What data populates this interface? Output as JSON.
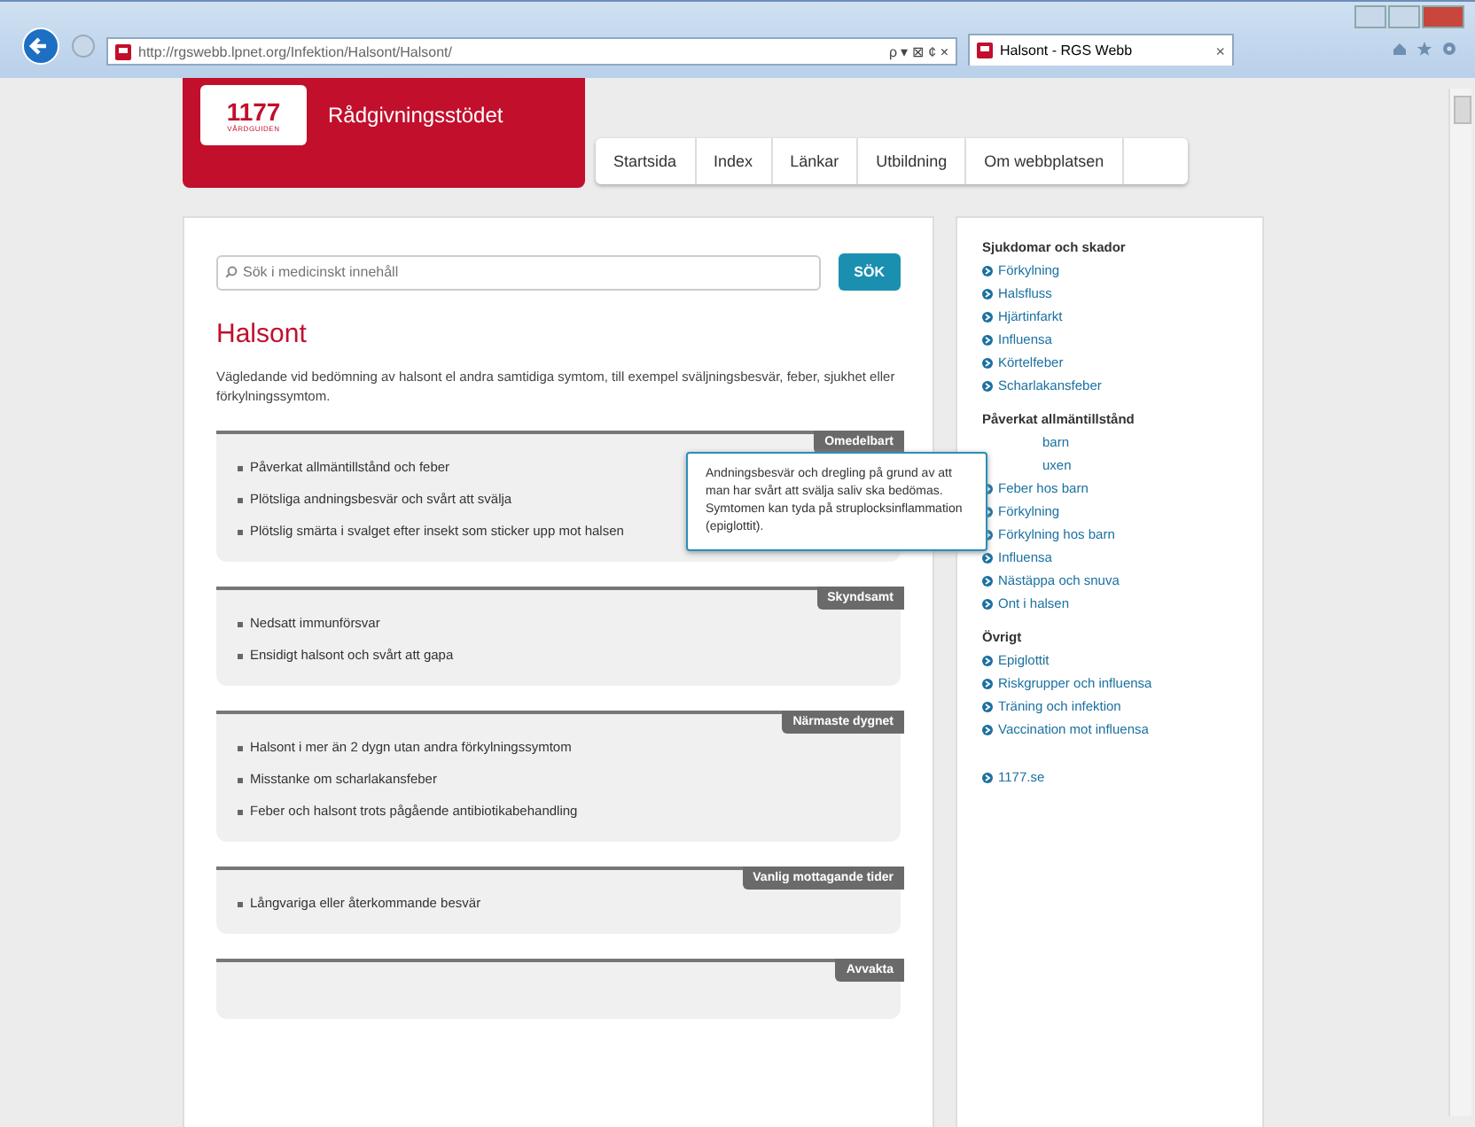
{
  "browser": {
    "address": "http://rgswebb.lpnet.org/Infektion/Halsont/Halsont/",
    "address_tools": "ρ ▾ ⊠ ¢ ×",
    "tab_title": "Halsont - RGS Webb",
    "tab_close": "×"
  },
  "header": {
    "logo_number": "1177",
    "logo_sub": "VÅRDGUIDEN",
    "site_title": "Rådgivningsstödet"
  },
  "nav": [
    {
      "label": "Startsida"
    },
    {
      "label": "Index"
    },
    {
      "label": "Länkar"
    },
    {
      "label": "Utbildning"
    },
    {
      "label": "Om webbplatsen"
    }
  ],
  "search": {
    "placeholder": "Sök i medicinskt innehåll",
    "button": "SÖK"
  },
  "title": "Halsont",
  "intro": "Vägledande vid bedömning av halsont el andra samtidiga symtom, till exempel sväljningsbesvär, feber, sjukhet eller förkylningssymtom.",
  "sections": [
    {
      "label": "Omedelbart",
      "items": [
        "Påverkat allmäntillstånd och feber",
        "Plötsliga andningsbesvär och svårt att svälja",
        "Plötslig smärta i svalget efter insekt som sticker upp mot halsen"
      ],
      "tooltip": "Andningsbesvär och dregling på grund av att man har svårt att svälja saliv ska bedömas. Symtomen kan tyda på struplocksinflammation (epiglottit)."
    },
    {
      "label": "Skyndsamt",
      "items": [
        "Nedsatt immunförsvar",
        "Ensidigt halsont och svårt att gapa"
      ]
    },
    {
      "label": "Närmaste dygnet",
      "items": [
        "Halsont i mer än 2 dygn utan andra förkylningssymtom",
        "Misstanke om scharlakansfeber",
        "Feber och halsont trots pågående antibiotikabehandling"
      ]
    },
    {
      "label": "Vanlig mottagande tider",
      "items": [
        "Långvariga eller återkommande besvär"
      ]
    },
    {
      "label": "Avvakta"
    }
  ],
  "sidebar": [
    {
      "heading": "Sjukdomar och skador",
      "links": [
        {
          "kind": "link",
          "label": "Förkylning"
        },
        {
          "kind": "link",
          "label": "Halsfluss"
        },
        {
          "kind": "link",
          "label": "Hjärtinfarkt"
        },
        {
          "kind": "link",
          "label": "Influensa"
        },
        {
          "kind": "link",
          "label": "Körtelfeber"
        },
        {
          "kind": "link",
          "label": "Scharlakansfeber"
        }
      ]
    },
    {
      "heading": "Påverkat allmäntillstånd",
      "links": [
        {
          "kind": "covered",
          "label": "barn"
        },
        {
          "kind": "covered",
          "label": "uxen"
        },
        {
          "kind": "link",
          "label": "Feber hos barn"
        },
        {
          "kind": "link",
          "label": "Förkylning"
        },
        {
          "kind": "link",
          "label": "Förkylning hos barn"
        },
        {
          "kind": "link",
          "label": "Influensa"
        },
        {
          "kind": "link",
          "label": "Nästäppa och snuva"
        },
        {
          "kind": "link",
          "label": "Ont i halsen"
        }
      ]
    },
    {
      "heading": "Övrigt",
      "links": [
        {
          "kind": "link",
          "label": "Epiglottit"
        },
        {
          "kind": "link",
          "label": "Riskgrupper och influensa"
        },
        {
          "kind": "link",
          "label": "Träning och infektion"
        },
        {
          "kind": "link",
          "label": "Vaccination mot influensa"
        }
      ]
    },
    {
      "links": [
        {
          "kind": "link",
          "label": "1177.se"
        }
      ]
    }
  ]
}
